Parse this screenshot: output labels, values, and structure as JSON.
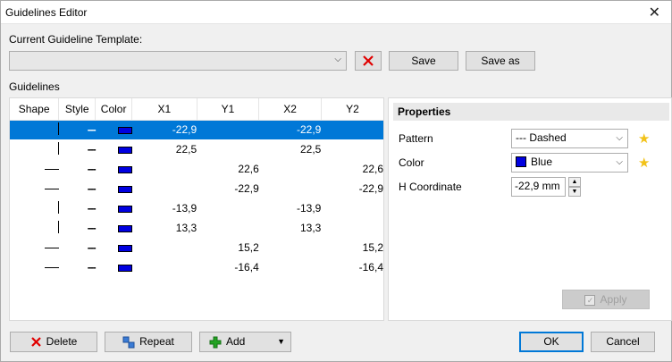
{
  "window": {
    "title": "Guidelines Editor"
  },
  "template": {
    "label": "Current Guideline Template:",
    "value": "",
    "save_label": "Save",
    "save_as_label": "Save as"
  },
  "guidelines": {
    "label": "Guidelines",
    "columns": [
      "Shape",
      "Style",
      "Color",
      "X1",
      "Y1",
      "X2",
      "Y2"
    ],
    "rows": [
      {
        "shape": "vertical",
        "style": "---",
        "color": "#0000e0",
        "x1": "-22,9",
        "y1": "",
        "x2": "-22,9",
        "y2": ""
      },
      {
        "shape": "vertical",
        "style": "---",
        "color": "#0000e0",
        "x1": "22,5",
        "y1": "",
        "x2": "22,5",
        "y2": ""
      },
      {
        "shape": "horizontal",
        "style": "---",
        "color": "#0000e0",
        "x1": "",
        "y1": "22,6",
        "x2": "",
        "y2": "22,6"
      },
      {
        "shape": "horizontal",
        "style": "---",
        "color": "#0000e0",
        "x1": "",
        "y1": "-22,9",
        "x2": "",
        "y2": "-22,9"
      },
      {
        "shape": "vertical",
        "style": "---",
        "color": "#0000e0",
        "x1": "-13,9",
        "y1": "",
        "x2": "-13,9",
        "y2": ""
      },
      {
        "shape": "vertical",
        "style": "---",
        "color": "#0000e0",
        "x1": "13,3",
        "y1": "",
        "x2": "13,3",
        "y2": ""
      },
      {
        "shape": "horizontal",
        "style": "---",
        "color": "#0000e0",
        "x1": "",
        "y1": "15,2",
        "x2": "",
        "y2": "15,2"
      },
      {
        "shape": "horizontal",
        "style": "---",
        "color": "#0000e0",
        "x1": "",
        "y1": "-16,4",
        "x2": "",
        "y2": "-16,4"
      }
    ]
  },
  "properties": {
    "header": "Properties",
    "pattern_label": "Pattern",
    "pattern_value": "--- Dashed",
    "color_label": "Color",
    "color_value": "Blue",
    "color_swatch": "#0000e0",
    "hcoord_label": "H Coordinate",
    "hcoord_value": "-22,9 mm",
    "apply_label": "Apply"
  },
  "footer": {
    "delete_label": "Delete",
    "repeat_label": "Repeat",
    "add_label": "Add",
    "ok_label": "OK",
    "cancel_label": "Cancel"
  },
  "colors": {
    "selection": "#0078d7",
    "star": "#f2c218",
    "delete_red": "#e00000",
    "add_green": "#22a322"
  }
}
